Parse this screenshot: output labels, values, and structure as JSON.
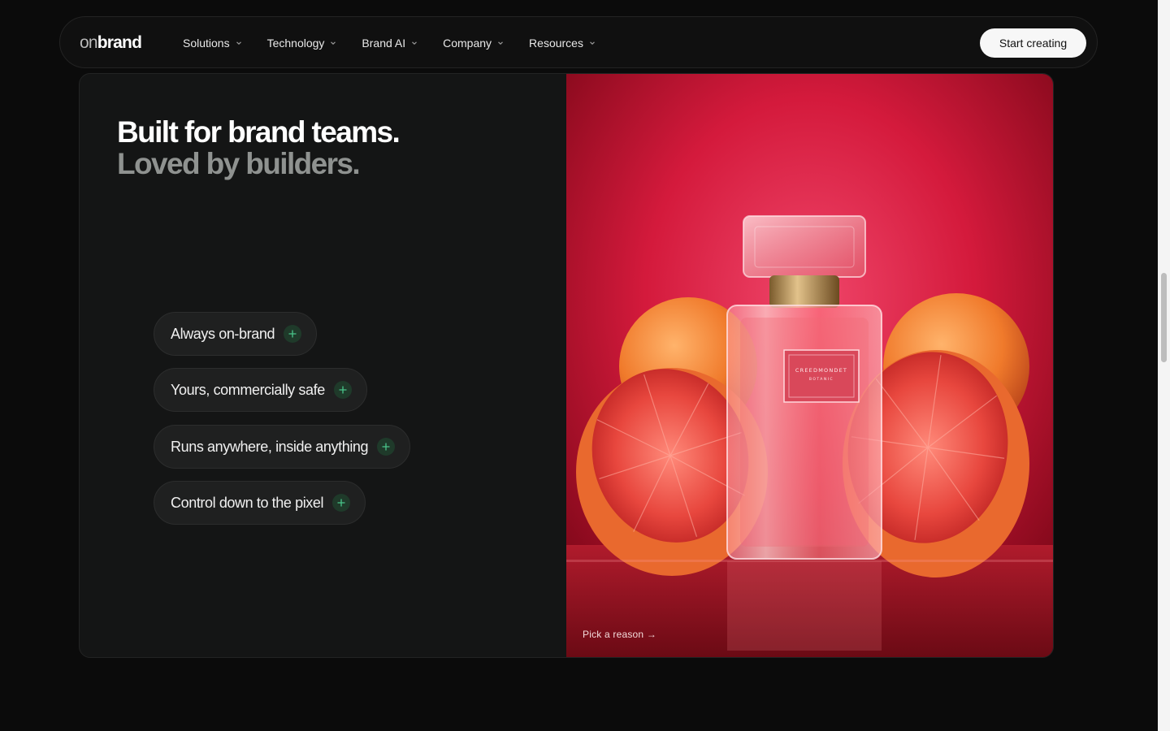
{
  "nav": {
    "logo_on": "on",
    "logo_brand": "brand",
    "items": [
      "Solutions",
      "Technology",
      "Brand AI",
      "Company",
      "Resources"
    ],
    "cta_label": "Start creating"
  },
  "hero": {
    "headline_line1": "Built for brand teams.",
    "headline_line2": "Loved by builders.",
    "reasons": [
      "Always on-brand",
      "Yours, commercially safe",
      "Runs anywhere, inside anything",
      "Control down to the pixel"
    ],
    "pick_label": "Pick a reason →",
    "bottle_label_line1": "CREEDMONDET",
    "bottle_label_line2": "BOTANIC"
  },
  "colors": {
    "accent_green": "#49c58a",
    "background": "#0b0b0b",
    "card": "#141515",
    "visual_red": "#d61f3f"
  },
  "icons": {
    "chevron": "chevron-down-icon",
    "plus": "plus-icon"
  }
}
